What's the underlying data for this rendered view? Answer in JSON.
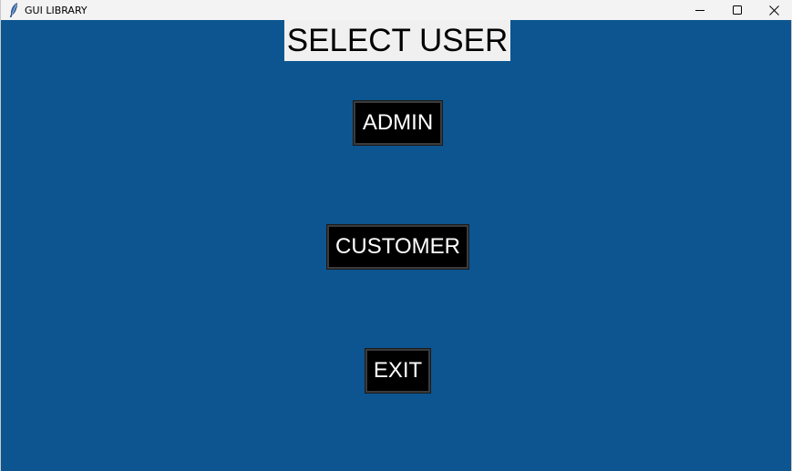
{
  "window": {
    "title": "GUI LIBRARY",
    "icon": "feather-icon",
    "background_color": "#0c5590"
  },
  "titlebar": {
    "controls": [
      "minimize-icon",
      "maximize-icon",
      "close-icon"
    ]
  },
  "main": {
    "heading": "SELECT USER",
    "buttons": {
      "admin": "ADMIN",
      "customer": "CUSTOMER",
      "exit": "EXIT"
    },
    "button_color": "#000000",
    "button_text_color": "#ffffff"
  }
}
